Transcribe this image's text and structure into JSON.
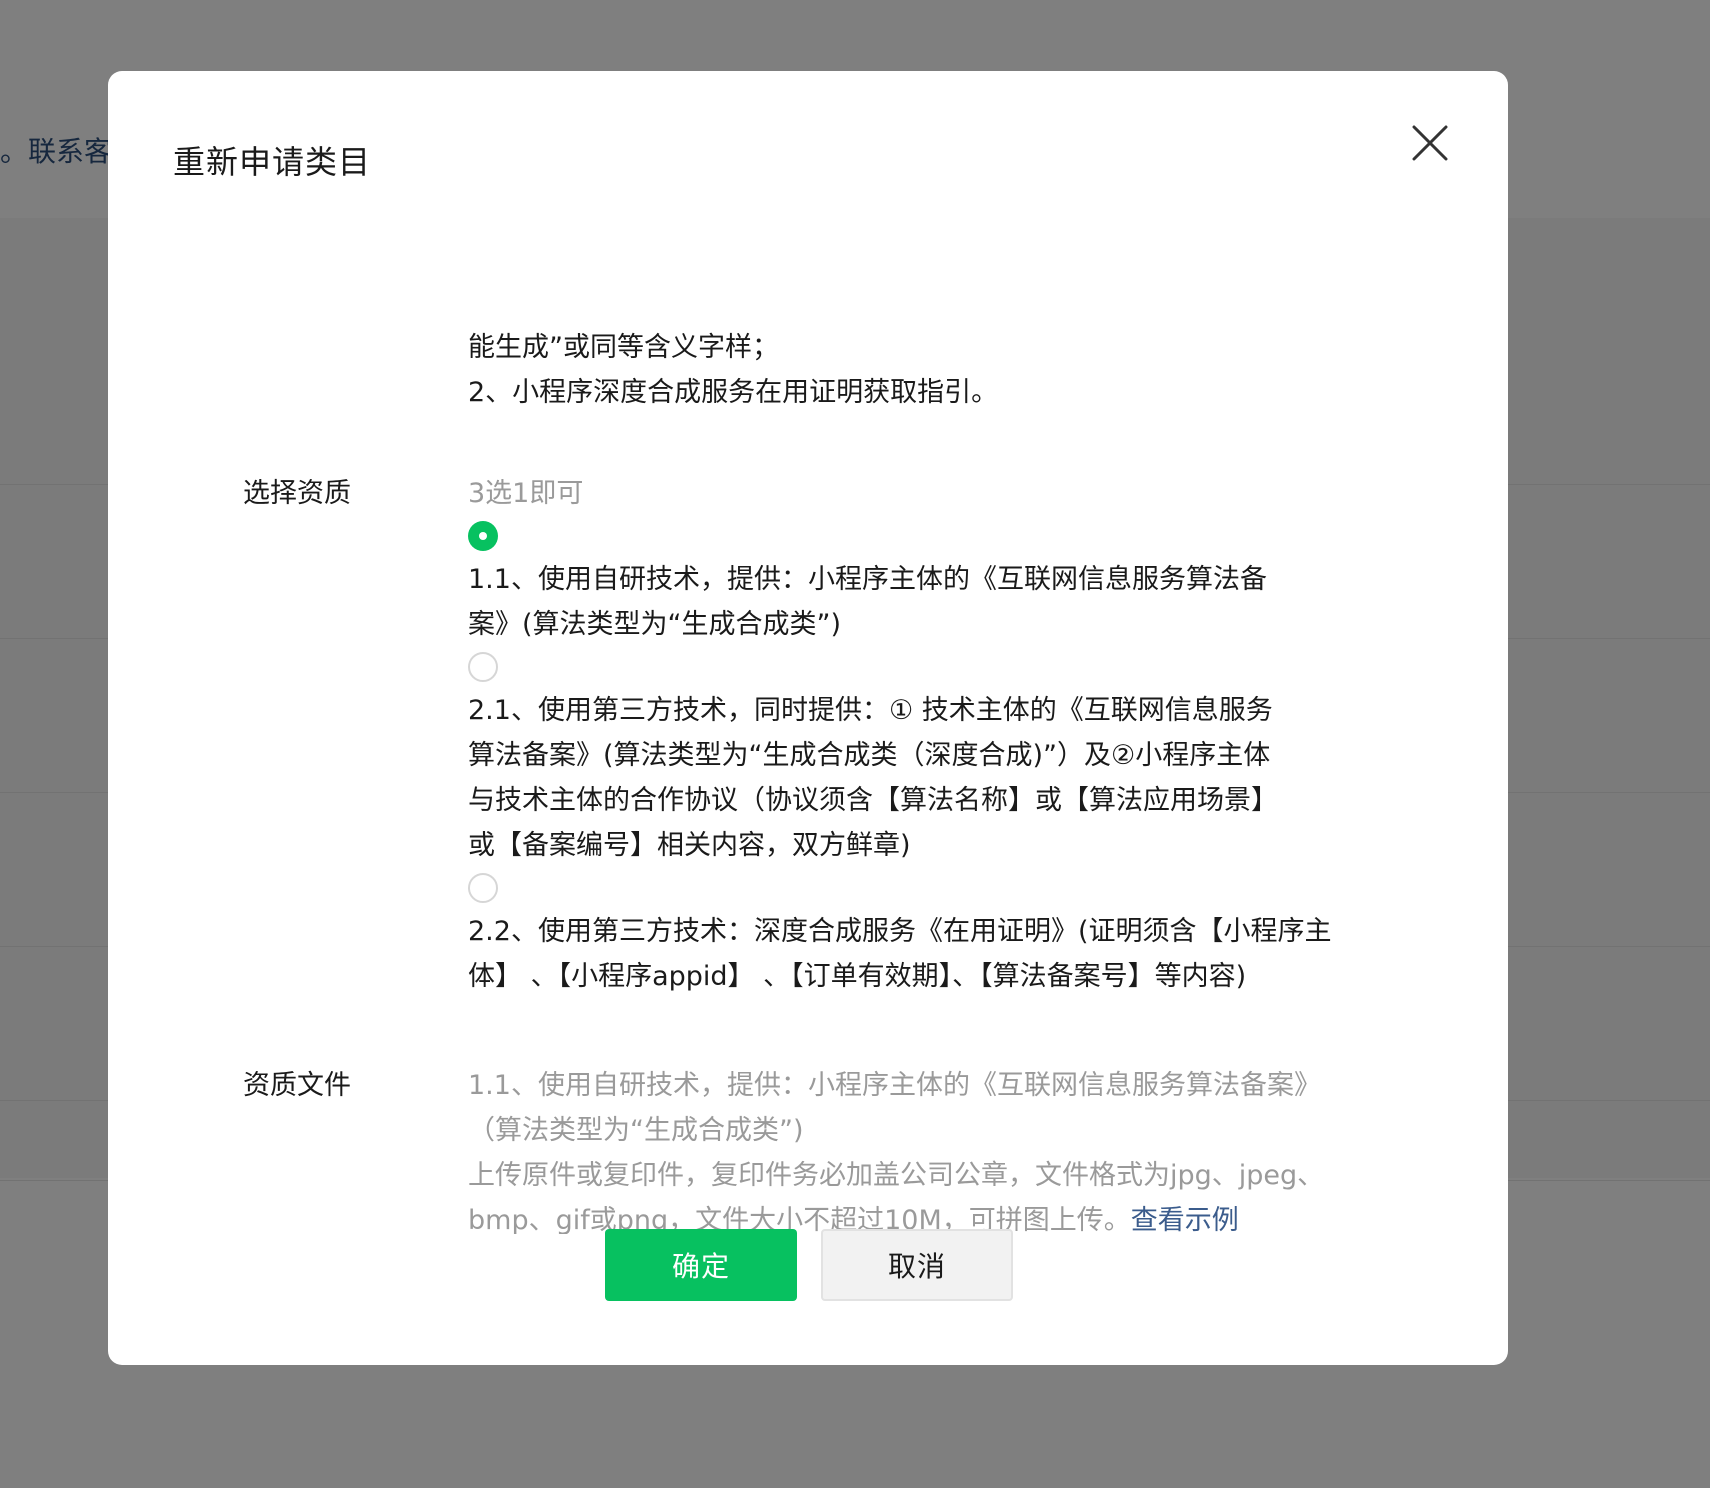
{
  "background": {
    "link_text": "。联系客"
  },
  "dialog": {
    "title": "重新申请类目",
    "close_icon": "close-icon",
    "intro_lines": [
      "能生成”或同等含义字样；",
      "2、小程序深度合成服务在用证明获取指引。"
    ],
    "qualification": {
      "label": "选择资质",
      "hint": "3选1即可",
      "options": [
        {
          "checked": true,
          "lines": [
            "1.1、使用自研技术，提供：小程序主体的《互联网信息服务算法备",
            "案》(算法类型为“生成合成类”)"
          ]
        },
        {
          "checked": false,
          "lines": [
            "2.1、使用第三方技术，同时提供：① 技术主体的《互联网信息服务",
            "算法备案》(算法类型为“生成合成类（深度合成)”）及②小程序主体",
            "与技术主体的合作协议（协议须含【算法名称】或【算法应用场景】",
            "或【备案编号】相关内容，双方鲜章)"
          ]
        },
        {
          "checked": false,
          "lines": [
            "2.2、使用第三方技术：深度合成服务《在用证明》(证明须含【小程序主",
            "体】 、【小程序appid】 、【订单有效期】、【算法备案号】等内容)"
          ]
        }
      ]
    },
    "files": {
      "label": "资质文件",
      "lines": [
        "1.1、使用自研技术，提供：小程序主体的《互联网信息服务算法备案》",
        "（算法类型为“生成合成类”)",
        "上传原件或复印件，复印件务必加盖公司公章，文件格式为jpg、jpeg、",
        "bmp、gif或png，文件大小不超过10M，可拼图上传。"
      ],
      "example_link": "查看示例"
    },
    "confirm_label": "确定",
    "cancel_label": "取消"
  },
  "colors": {
    "primary": "#07c160",
    "link": "#3b5c8c",
    "muted": "#9a9a9a"
  }
}
